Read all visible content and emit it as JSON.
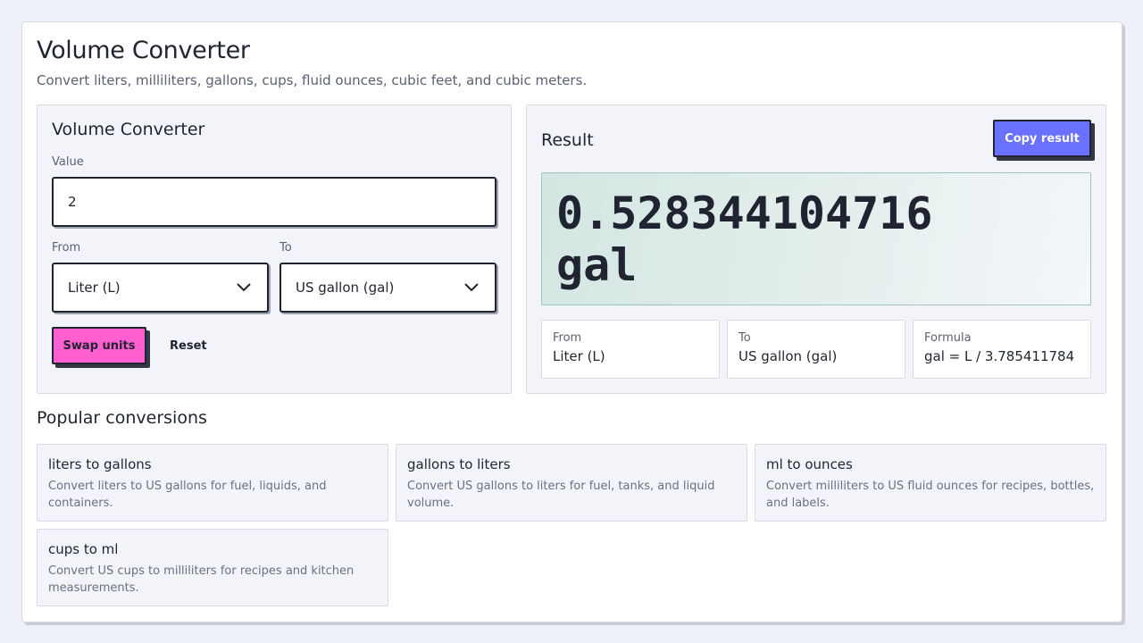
{
  "header": {
    "title": "Volume Converter",
    "subtitle": "Convert liters, milliliters, gallons, cups, fluid ounces, cubic feet, and cubic meters."
  },
  "converter": {
    "title": "Volume Converter",
    "value_label": "Value",
    "value": "2",
    "from_label": "From",
    "from_selected": "Liter (L)",
    "to_label": "To",
    "to_selected": "US gallon (gal)",
    "swap_label": "Swap units",
    "reset_label": "Reset"
  },
  "result": {
    "title": "Result",
    "copy_label": "Copy result",
    "value_line1": "0.528344104716",
    "value_line2": "gal",
    "info": [
      {
        "label": "From",
        "value": "Liter (L)"
      },
      {
        "label": "To",
        "value": "US gallon (gal)"
      },
      {
        "label": "Formula",
        "value": "gal = L / 3.785411784"
      }
    ]
  },
  "popular": {
    "title": "Popular conversions",
    "items": [
      {
        "title": "liters to gallons",
        "desc": "Convert liters to US gallons for fuel, liquids, and containers."
      },
      {
        "title": "gallons to liters",
        "desc": "Convert US gallons to liters for fuel, tanks, and liquid volume."
      },
      {
        "title": "ml to ounces",
        "desc": "Convert milliliters to US fluid ounces for recipes, bottles, and labels."
      },
      {
        "title": "cups to ml",
        "desc": "Convert US cups to milliliters for recipes and kitchen measurements."
      }
    ]
  },
  "colors": {
    "swap_button": "#ff5fd0",
    "copy_button": "#6a70ff",
    "result_border": "#9cc7bf"
  }
}
